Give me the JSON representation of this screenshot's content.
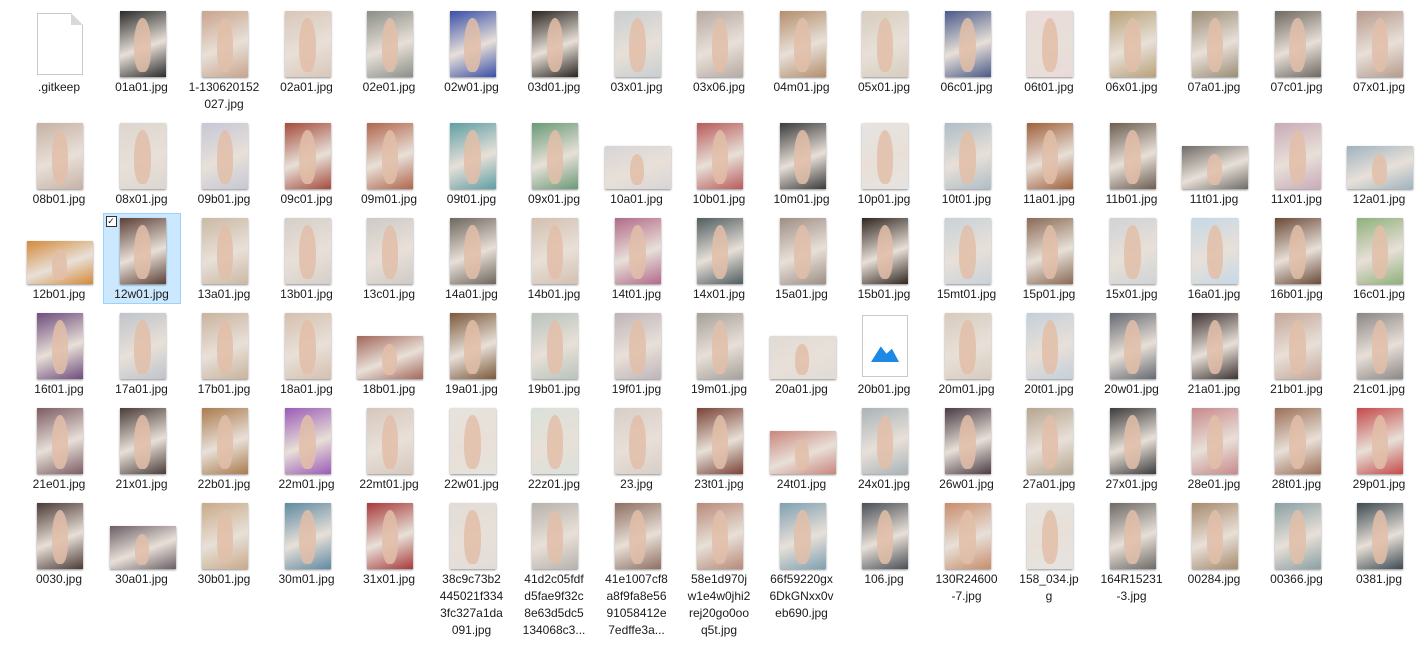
{
  "files": [
    {
      "name": ".gitkeep",
      "kind": "generic-file-icon"
    },
    {
      "name": "01a01.jpg",
      "kind": "portrait",
      "color": "#2b2b2b"
    },
    {
      "name": "1-130620152027.jpg",
      "kind": "portrait",
      "color": "#c9a48c"
    },
    {
      "name": "02a01.jpg",
      "kind": "portrait",
      "color": "#d9c7b8"
    },
    {
      "name": "02e01.jpg",
      "kind": "portrait",
      "color": "#8a8f88"
    },
    {
      "name": "02w01.jpg",
      "kind": "portrait",
      "color": "#3a4fa8"
    },
    {
      "name": "03d01.jpg",
      "kind": "portrait",
      "color": "#2a2420"
    },
    {
      "name": "03x01.jpg",
      "kind": "portrait",
      "color": "#c8ced2"
    },
    {
      "name": "03x06.jpg",
      "kind": "portrait",
      "color": "#b7aaa3"
    },
    {
      "name": "04m01.jpg",
      "kind": "portrait",
      "color": "#b48e6d"
    },
    {
      "name": "05x01.jpg",
      "kind": "portrait",
      "color": "#d7cdbf"
    },
    {
      "name": "06c01.jpg",
      "kind": "portrait",
      "color": "#4a5a8a"
    },
    {
      "name": "06t01.jpg",
      "kind": "portrait",
      "color": "#e9dada"
    },
    {
      "name": "06x01.jpg",
      "kind": "portrait",
      "color": "#b9a27a"
    },
    {
      "name": "07a01.jpg",
      "kind": "portrait",
      "color": "#9b8e77"
    },
    {
      "name": "07c01.jpg",
      "kind": "portrait",
      "color": "#6f6962"
    },
    {
      "name": "07x01.jpg",
      "kind": "portrait",
      "color": "#b79a8d"
    },
    {
      "name": "08b01.jpg",
      "kind": "portrait",
      "color": "#c7b1a5"
    },
    {
      "name": "08x01.jpg",
      "kind": "portrait",
      "color": "#ddd6d0"
    },
    {
      "name": "09b01.jpg",
      "kind": "portrait",
      "color": "#c6c8d6"
    },
    {
      "name": "09c01.jpg",
      "kind": "portrait",
      "color": "#a54b3c"
    },
    {
      "name": "09m01.jpg",
      "kind": "portrait",
      "color": "#b0664c"
    },
    {
      "name": "09t01.jpg",
      "kind": "portrait",
      "color": "#5f9fa5"
    },
    {
      "name": "09x01.jpg",
      "kind": "portrait",
      "color": "#6a9a78"
    },
    {
      "name": "10a01.jpg",
      "kind": "landscape",
      "color": "#d8d5d8"
    },
    {
      "name": "10b01.jpg",
      "kind": "portrait",
      "color": "#b75b5b"
    },
    {
      "name": "10m01.jpg",
      "kind": "portrait",
      "color": "#3b3b3b"
    },
    {
      "name": "10p01.jpg",
      "kind": "portrait",
      "color": "#e6e3e1"
    },
    {
      "name": "10t01.jpg",
      "kind": "portrait",
      "color": "#aebdc7"
    },
    {
      "name": "11a01.jpg",
      "kind": "portrait",
      "color": "#a0603b"
    },
    {
      "name": "11b01.jpg",
      "kind": "portrait",
      "color": "#6d5e52"
    },
    {
      "name": "11t01.jpg",
      "kind": "landscape",
      "color": "#6f6b66"
    },
    {
      "name": "11x01.jpg",
      "kind": "portrait",
      "color": "#c9aab8"
    },
    {
      "name": "12a01.jpg",
      "kind": "landscape",
      "color": "#9fb3bf"
    },
    {
      "name": "12b01.jpg",
      "kind": "landscape",
      "color": "#d48a3a"
    },
    {
      "name": "12w01.jpg",
      "kind": "portrait",
      "color": "#5c4036",
      "selected": true
    },
    {
      "name": "13a01.jpg",
      "kind": "portrait",
      "color": "#cbb9a4"
    },
    {
      "name": "13b01.jpg",
      "kind": "portrait",
      "color": "#d6cfc9"
    },
    {
      "name": "13c01.jpg",
      "kind": "portrait",
      "color": "#cfcac7"
    },
    {
      "name": "14a01.jpg",
      "kind": "portrait",
      "color": "#6e675e"
    },
    {
      "name": "14b01.jpg",
      "kind": "portrait",
      "color": "#d3c0b0"
    },
    {
      "name": "14t01.jpg",
      "kind": "portrait",
      "color": "#b26a8a"
    },
    {
      "name": "14x01.jpg",
      "kind": "portrait",
      "color": "#4f5d60"
    },
    {
      "name": "15a01.jpg",
      "kind": "portrait",
      "color": "#9d8f86"
    },
    {
      "name": "15b01.jpg",
      "kind": "portrait",
      "color": "#2f2620"
    },
    {
      "name": "15mt01.jpg",
      "kind": "portrait",
      "color": "#c8d2d9"
    },
    {
      "name": "15p01.jpg",
      "kind": "portrait",
      "color": "#8a6a55"
    },
    {
      "name": "15x01.jpg",
      "kind": "portrait",
      "color": "#cfd3d6"
    },
    {
      "name": "16a01.jpg",
      "kind": "portrait",
      "color": "#c6d8e6"
    },
    {
      "name": "16b01.jpg",
      "kind": "portrait",
      "color": "#6a4a38"
    },
    {
      "name": "16c01.jpg",
      "kind": "portrait",
      "color": "#8fb07a"
    },
    {
      "name": "16t01.jpg",
      "kind": "portrait",
      "color": "#6e4c7d"
    },
    {
      "name": "17a01.jpg",
      "kind": "portrait",
      "color": "#bfc4cb"
    },
    {
      "name": "17b01.jpg",
      "kind": "portrait",
      "color": "#c9b49e"
    },
    {
      "name": "18a01.jpg",
      "kind": "portrait",
      "color": "#d6c0ae"
    },
    {
      "name": "18b01.jpg",
      "kind": "landscape",
      "color": "#a3675a"
    },
    {
      "name": "19a01.jpg",
      "kind": "portrait",
      "color": "#7b5a3c"
    },
    {
      "name": "19b01.jpg",
      "kind": "portrait",
      "color": "#b8c4bd"
    },
    {
      "name": "19f01.jpg",
      "kind": "portrait",
      "color": "#bfb5ba"
    },
    {
      "name": "19m01.jpg",
      "kind": "portrait",
      "color": "#a5a09a"
    },
    {
      "name": "20a01.jpg",
      "kind": "landscape",
      "color": "#e0dbd6"
    },
    {
      "name": "20b01.jpg",
      "kind": "picture-icon"
    },
    {
      "name": "20m01.jpg",
      "kind": "portrait",
      "color": "#d7cbbd"
    },
    {
      "name": "20t01.jpg",
      "kind": "portrait",
      "color": "#c4cfdb"
    },
    {
      "name": "20w01.jpg",
      "kind": "portrait",
      "color": "#656a72"
    },
    {
      "name": "21a01.jpg",
      "kind": "portrait",
      "color": "#3e3434"
    },
    {
      "name": "21b01.jpg",
      "kind": "portrait",
      "color": "#c5a79a"
    },
    {
      "name": "21c01.jpg",
      "kind": "portrait",
      "color": "#8c8786"
    },
    {
      "name": "21e01.jpg",
      "kind": "portrait",
      "color": "#7d5c64"
    },
    {
      "name": "21x01.jpg",
      "kind": "portrait",
      "color": "#4b3d3a"
    },
    {
      "name": "22b01.jpg",
      "kind": "portrait",
      "color": "#aa7c4f"
    },
    {
      "name": "22m01.jpg",
      "kind": "portrait",
      "color": "#9b5bb7"
    },
    {
      "name": "22mt01.jpg",
      "kind": "portrait",
      "color": "#d7c7bd"
    },
    {
      "name": "22w01.jpg",
      "kind": "portrait",
      "color": "#e6e2dd"
    },
    {
      "name": "22z01.jpg",
      "kind": "portrait",
      "color": "#d9e1da"
    },
    {
      "name": "23.jpg",
      "kind": "portrait",
      "color": "#d8cec8"
    },
    {
      "name": "23t01.jpg",
      "kind": "portrait",
      "color": "#7a4336"
    },
    {
      "name": "24t01.jpg",
      "kind": "landscape",
      "color": "#c9867c"
    },
    {
      "name": "24x01.jpg",
      "kind": "portrait",
      "color": "#a9b3b8"
    },
    {
      "name": "26w01.jpg",
      "kind": "portrait",
      "color": "#4a3b45"
    },
    {
      "name": "27a01.jpg",
      "kind": "portrait",
      "color": "#b6a690"
    },
    {
      "name": "27x01.jpg",
      "kind": "portrait",
      "color": "#3c3c3c"
    },
    {
      "name": "28e01.jpg",
      "kind": "portrait",
      "color": "#c88a8c"
    },
    {
      "name": "28t01.jpg",
      "kind": "portrait",
      "color": "#9c7058"
    },
    {
      "name": "29p01.jpg",
      "kind": "portrait",
      "color": "#c44a4a"
    },
    {
      "name": "0030.jpg",
      "kind": "portrait",
      "color": "#4b3a35"
    },
    {
      "name": "30a01.jpg",
      "kind": "landscape",
      "color": "#6a5f65"
    },
    {
      "name": "30b01.jpg",
      "kind": "portrait",
      "color": "#c9aa8a"
    },
    {
      "name": "30m01.jpg",
      "kind": "portrait",
      "color": "#5f8aa2"
    },
    {
      "name": "31x01.jpg",
      "kind": "portrait",
      "color": "#a83a3a"
    },
    {
      "name": "38c9c73b2445021f3343fc327a1da091.jpg",
      "display": "38c9c73b2\n445021f334\n3fc327a1da\n091.jpg",
      "kind": "portrait",
      "color": "#e2dcd8"
    },
    {
      "name": "41d2c05fdfd5fae9f32c8e63d5dc5134068c3...",
      "display": "41d2c05fdf\nd5fae9f32c\n8e63d5dc5\n134068c3...",
      "kind": "portrait",
      "color": "#b8b2ad"
    },
    {
      "name": "41e1007cf8a8f9fa8e5691058412e7edffe3a...",
      "display": "41e1007cf8\na8f9fa8e56\n91058412e\n7edffe3a...",
      "kind": "portrait",
      "color": "#8f6f62"
    },
    {
      "name": "58e1d970jw1e4w0jhi2rej20go0ooq5t.jpg",
      "display": "58e1d970j\nw1e4w0jhi2\nrej20go0oo\nq5t.jpg",
      "kind": "portrait",
      "color": "#b88a78"
    },
    {
      "name": "66f59220gx6DkGNxx0veb690.jpg",
      "display": "66f59220gx\n6DkGNxx0v\neb690.jpg",
      "kind": "portrait",
      "color": "#7fa0b2"
    },
    {
      "name": "106.jpg",
      "kind": "portrait",
      "color": "#4a4f56"
    },
    {
      "name": "130R24600-7.jpg",
      "display": "130R24600\n-7.jpg",
      "kind": "portrait",
      "color": "#c88d6c"
    },
    {
      "name": "158_034.jpg",
      "display": "158_034.jp\ng",
      "kind": "portrait",
      "color": "#e5e3e1"
    },
    {
      "name": "164R15231-3.jpg",
      "display": "164R15231\n-3.jpg",
      "kind": "portrait",
      "color": "#6e6a66"
    },
    {
      "name": "00284.jpg",
      "kind": "portrait",
      "color": "#a68b6e"
    },
    {
      "name": "00366.jpg",
      "kind": "portrait",
      "color": "#8aa0a3"
    },
    {
      "name": "0381.jpg",
      "kind": "portrait",
      "color": "#3d4a52"
    }
  ],
  "selection_checkbox_glyph": "✓"
}
